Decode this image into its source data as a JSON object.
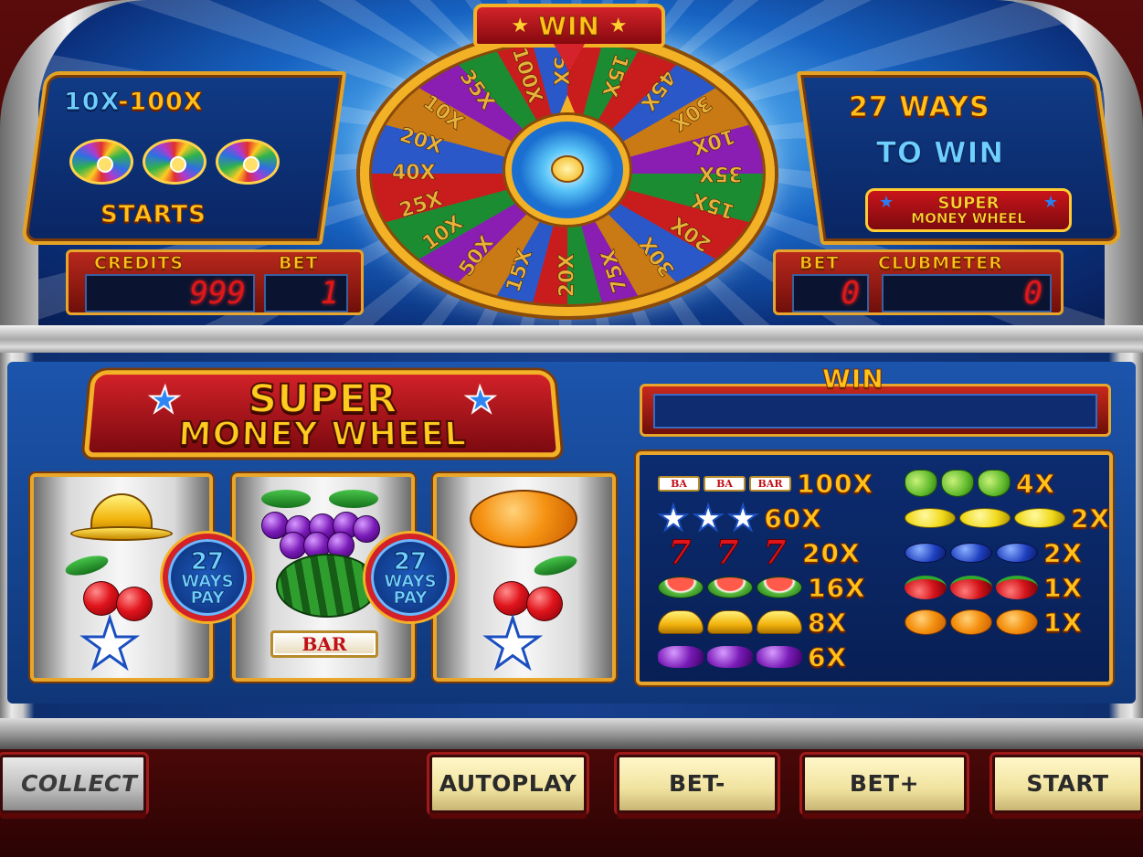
{
  "top": {
    "left_panel": {
      "range_a": "10X",
      "range_sep": "-",
      "range_b": "100X",
      "starts_label": "STARTS"
    },
    "right_panel": {
      "ways_line": "27 WAYS",
      "to_win_line": "TO WIN",
      "logo_line1": "SUPER",
      "logo_line2": "MONEY WHEEL"
    },
    "win_banner": "WIN",
    "wheel_segments": [
      "5X",
      "15X",
      "45X",
      "30X",
      "10X",
      "35X",
      "15X",
      "20X",
      "30X",
      "75X",
      "20X",
      "15X",
      "50X",
      "10X",
      "25X",
      "40X",
      "20X",
      "10X",
      "35X",
      "100X"
    ],
    "counters": {
      "credits_label": "CREDITS",
      "credits_value": "999",
      "bet_left_label": "BET",
      "bet_left_value": "1",
      "bet_right_label": "BET",
      "bet_right_value": "0",
      "clubmeter_label": "CLUBMETER",
      "clubmeter_value": "0"
    }
  },
  "logo": {
    "line1": "SUPER",
    "line2": "MONEY WHEEL"
  },
  "reels": {
    "badge_number": "27",
    "badge_line1": "WAYS",
    "badge_line2": "PAY",
    "bar_label": "BAR",
    "reel1": [
      "bell",
      "cherry",
      "star"
    ],
    "reel2": [
      "grapes",
      "watermelon",
      "bar"
    ],
    "reel3": [
      "orange",
      "cherry",
      "star"
    ]
  },
  "win": {
    "label": "WIN",
    "value": ""
  },
  "paytable": {
    "bar_text": "BAR",
    "bar_short": "BA",
    "left": [
      {
        "symbol": "bar",
        "multiplier": "100X"
      },
      {
        "symbol": "star",
        "multiplier": "60X"
      },
      {
        "symbol": "seven",
        "multiplier": "20X"
      },
      {
        "symbol": "watermelon",
        "multiplier": "16X"
      },
      {
        "symbol": "bell",
        "multiplier": "8X"
      },
      {
        "symbol": "grapes",
        "multiplier": "6X"
      }
    ],
    "right": [
      {
        "symbol": "pear",
        "multiplier": "4X"
      },
      {
        "symbol": "lemon",
        "multiplier": "2X"
      },
      {
        "symbol": "plum",
        "multiplier": "2X"
      },
      {
        "symbol": "cherry",
        "multiplier": "1X"
      },
      {
        "symbol": "orange",
        "multiplier": "1X"
      }
    ]
  },
  "buttons": {
    "collect": "COLLECT",
    "autoplay": "AUTOPLAY",
    "bet_minus": "BET-",
    "bet_plus": "BET+",
    "start": "START"
  },
  "icons": {
    "star": "star-icon",
    "seven": "7"
  },
  "colors": {
    "gold": "#ffc21a",
    "led_red": "#e01717",
    "panel_blue": "#0c2c70",
    "frame_gold": "#e7a62b"
  }
}
